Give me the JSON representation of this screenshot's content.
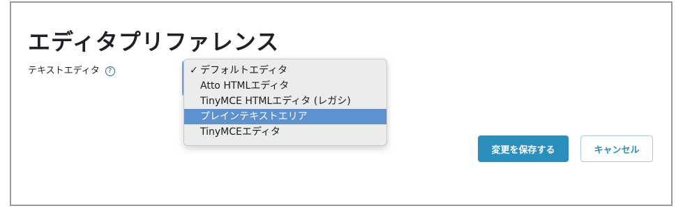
{
  "page": {
    "title": "エディタプリファレンス"
  },
  "field": {
    "label": "テキストエディタ",
    "help_icon": "question-circle-icon"
  },
  "editor_select": {
    "options": [
      {
        "label": "デフォルトエディタ",
        "checked": true
      },
      {
        "label": "Atto HTMLエディタ"
      },
      {
        "label": "TinyMCE HTMLエディタ (レガシ)"
      },
      {
        "label": "プレインテキストエリア",
        "highlighted": true
      },
      {
        "label": "TinyMCEエディタ"
      }
    ],
    "check_glyph": "✓"
  },
  "actions": {
    "save_label": "変更を保存する",
    "cancel_label": "キャンセル"
  },
  "colors": {
    "primary": "#2a8fbd",
    "highlight": "#5e91cf",
    "help_icon": "#0f6cbf"
  }
}
